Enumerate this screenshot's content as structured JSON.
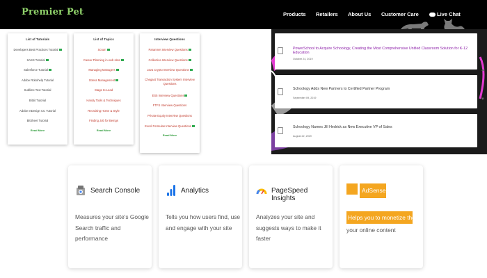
{
  "nav": {
    "brand": "Premier Pet",
    "items": [
      "Products",
      "Retailers",
      "About Us",
      "Customer Care",
      "Live Chat"
    ]
  },
  "lists": [
    {
      "title": "List of Tutorials",
      "items": [
        "Developers Best Practices Tutorial",
        "SASS Tutorial",
        "Salesforce Tutorial",
        "Adobe Robohelp Tutorial",
        "Sublime Text Tutorial",
        "Bitbit Tutorial",
        "Adobe InDesign CC Tutorial",
        "BitSheet Tutorial"
      ],
      "more": "Read More"
    },
    {
      "title": "List of Topics",
      "items": [
        "Scrum",
        "Career Planning in web sites",
        "Managing Managers",
        "Stress Management",
        "Stage to Lead",
        "Handy Tools & Techniques",
        "Recruiting Home & Style",
        "Finding Job for Beings"
      ],
      "more": "Read More"
    },
    {
      "title": "Interview Questions",
      "items": [
        "Paramnet Interview Questions",
        "Collectica Interview Questions",
        "Java Crypto Interview Questions",
        "Chegast Transaction System Interview Questions",
        "ES5 Interview Questions",
        "FTFS Interview Questions",
        "Private Equity Interview Questions",
        "Excel Formulas Interview Questions"
      ],
      "more": "Read More"
    }
  ],
  "news": [
    {
      "title": "PowerSchool to Acquire Schoology, Creating the Most Comprehensive Unified Classroom Solution for K-12 Education",
      "date": "October 24, 2019"
    },
    {
      "title": "Schoology Adds New Partners to Certified Partner Program",
      "date": "September 09, 2019"
    },
    {
      "title": "Schoology Names Jill Hedrick as New Executive VP of Sales",
      "date": "August 22, 2019"
    }
  ],
  "tools": [
    {
      "name": "Search Console",
      "desc": "Measures your site's Google Search traffic and performance"
    },
    {
      "name": "Analytics",
      "desc": "Tells you how users find, use and engage with your site"
    },
    {
      "name": "PageSpeed Insights",
      "desc": "Analyzes your site and suggests ways to make it faster"
    },
    {
      "name": "AdSense",
      "desc_highlight": "Helps you to monetize the space",
      "desc_rest": "your online content"
    }
  ],
  "colors": {
    "brand": "#8fd16a",
    "nav_bg": "#000000",
    "news_active": "#8c1fa8",
    "readmore": "#2e9b3a",
    "adsense": "#f4a620"
  }
}
